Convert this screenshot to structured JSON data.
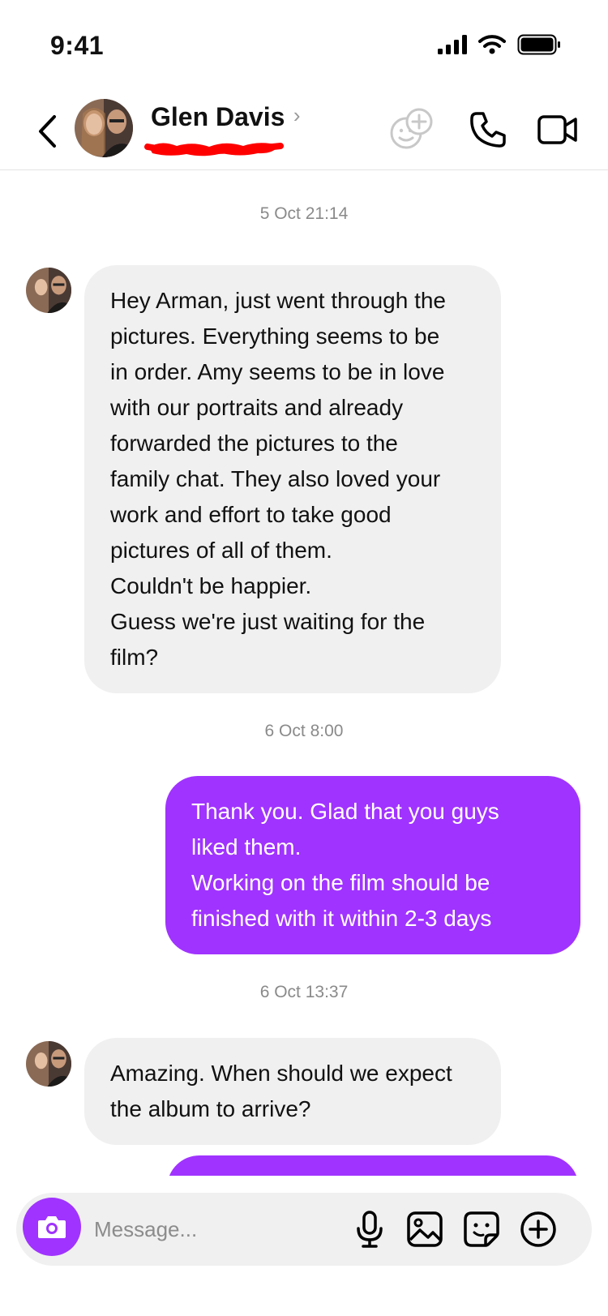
{
  "status_bar": {
    "time": "9:41"
  },
  "header": {
    "contact_name": "Glen Davis",
    "chevron": "›",
    "icons": [
      "back-icon",
      "add-people-icon",
      "phone-icon",
      "video-camera-icon"
    ]
  },
  "messages": [
    {
      "timestamp": "5 Oct 21:14",
      "direction": "incoming",
      "lines": [
        "Hey Arman, just went through the",
        "pictures. Everything seems to be",
        "in order. Amy seems to be in love",
        "with our portraits and already",
        "forwarded the pictures to the",
        "family chat. They also loved your",
        "work and effort to take good",
        "pictures of all of them.",
        "Couldn't be happier.",
        "Guess we're just waiting for the",
        "film?"
      ]
    },
    {
      "timestamp": "6 Oct 8:00",
      "direction": "outgoing",
      "lines": [
        "Thank you. Glad that you guys",
        "liked them.",
        "Working on the film should be",
        "finished with it within 2-3 days"
      ]
    },
    {
      "timestamp": "6 Oct 13:37",
      "direction": "incoming",
      "lines": [
        "Amazing. When should we expect",
        "the album to arrive?"
      ]
    }
  ],
  "composer": {
    "placeholder": "Message...",
    "icons": [
      "camera-icon",
      "microphone-icon",
      "image-icon",
      "sticker-icon",
      "plus-icon"
    ]
  },
  "colors": {
    "accent": "#a033ff",
    "incoming_bubble": "#f0f0f0",
    "timestamp": "#8a8a8a",
    "redaction": "#ff0000"
  }
}
